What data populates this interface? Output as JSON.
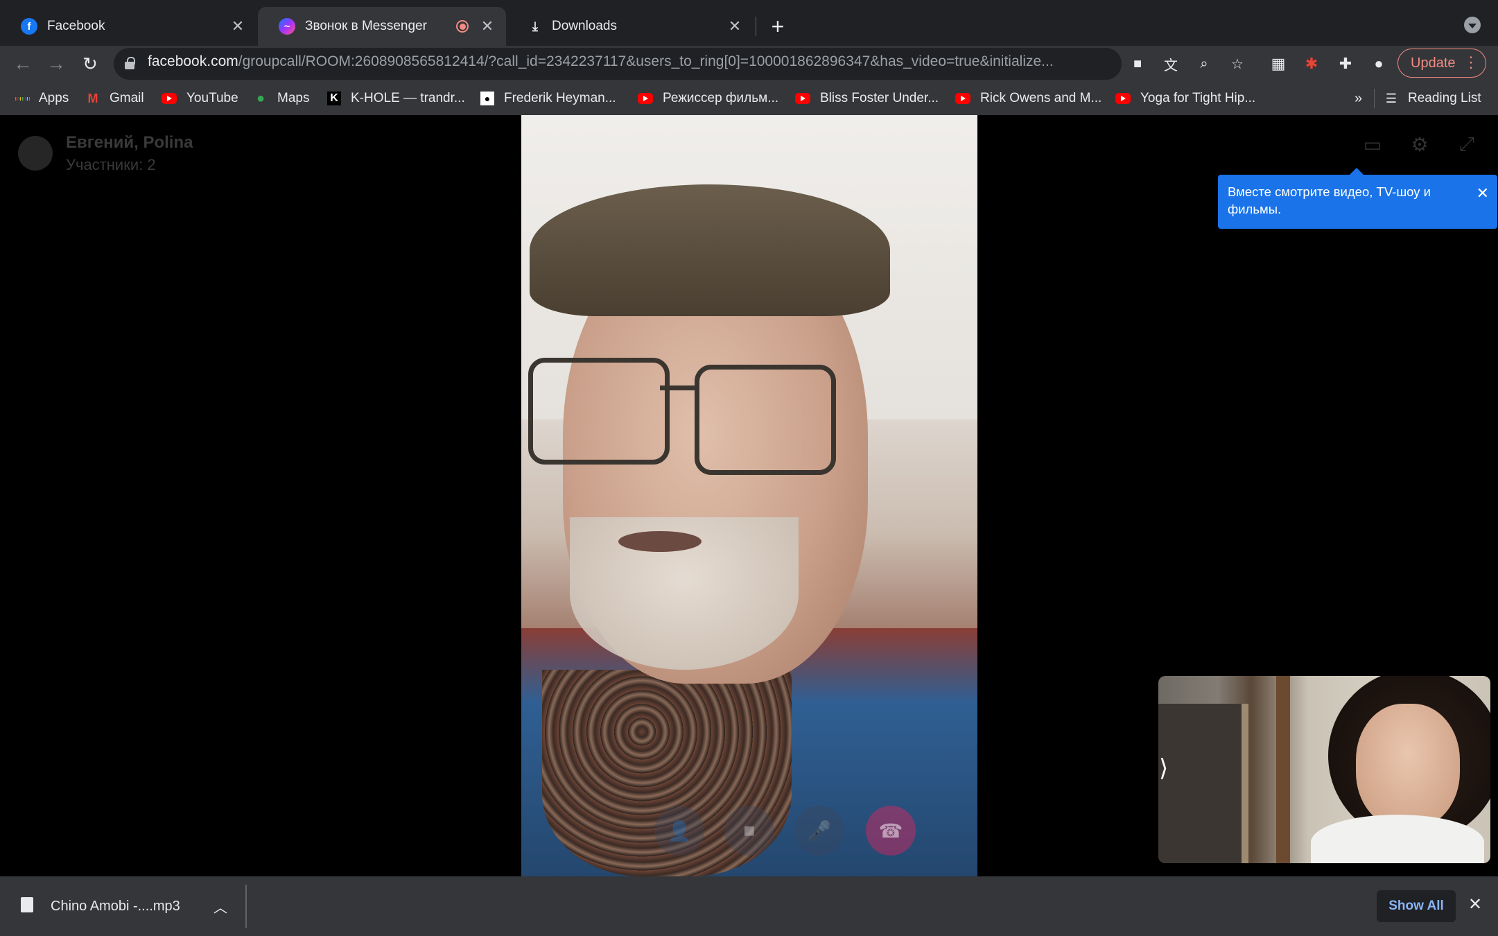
{
  "browser": {
    "tabs": [
      {
        "title": "Facebook",
        "favicon": "facebook-icon",
        "active": false
      },
      {
        "title": "Звонок в Messenger",
        "favicon": "messenger-icon",
        "active": true,
        "recording": true
      },
      {
        "title": "Downloads",
        "favicon": "download-icon",
        "active": false
      }
    ],
    "new_tab_label": "+",
    "close_glyph": "✕",
    "url_domain": "facebook.com",
    "url_path": "/groupcall/ROOM:2608908565812414/?call_id=2342237117&users_to_ring[0]=100001862896347&has_video=true&initialize...",
    "update_label": "Update",
    "reading_list_label": "Reading List",
    "overflow_label": "»"
  },
  "bookmarks": [
    {
      "label": "Apps",
      "icon": "apps-grid-icon"
    },
    {
      "label": "Gmail",
      "icon": "gmail-icon"
    },
    {
      "label": "YouTube",
      "icon": "youtube-icon"
    },
    {
      "label": "Maps",
      "icon": "maps-icon"
    },
    {
      "label": "K-HOLE — trandr...",
      "icon": "k-hole-icon"
    },
    {
      "label": "Frederik Heyman...",
      "icon": "frederik-icon"
    },
    {
      "label": "Режиссер фильм...",
      "icon": "youtube-icon"
    },
    {
      "label": "Bliss Foster Under...",
      "icon": "youtube-icon"
    },
    {
      "label": "Rick Owens and M...",
      "icon": "youtube-icon"
    },
    {
      "label": "Yoga for Tight Hip...",
      "icon": "youtube-icon"
    }
  ],
  "call": {
    "participants_name": "Евгений, Polina",
    "participants_count": "Участники: 2",
    "tooltip_text": "Вместе смотрите видео, TV-шоу и фильмы.",
    "controls": [
      "add-person-icon",
      "camera-icon",
      "microphone-icon",
      "end-call-icon"
    ],
    "self_view_toggle": "⟩"
  },
  "downloads": {
    "file_name": "Chino Amobi -....mp3",
    "show_all_label": "Show All"
  },
  "colors": {
    "tab_bar": "#202124",
    "toolbar": "#35363a",
    "accent_blue": "#1a73e8",
    "update_red": "#f28b82",
    "end_call_red": "#e0245e"
  }
}
